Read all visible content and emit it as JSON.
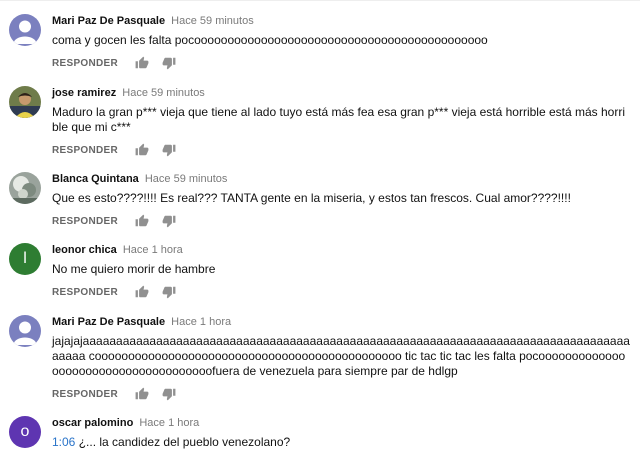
{
  "reply_label": "RESPONDER",
  "icons": {
    "like": "thumb-up-icon",
    "dislike": "thumb-down-icon"
  },
  "comments": [
    {
      "author": "Mari Paz De Pasquale",
      "time": "Hace 59 minutos",
      "text": "coma y gocen les falta pocoooooooooooooooooooooooooooooooooooooooooooo",
      "avatar": "default"
    },
    {
      "author": "jose ramirez",
      "time": "Hace 59 minutos",
      "text": "Maduro la gran p*** vieja que tiene al lado tuyo está más fea esa gran p*** vieja está horrible está más horrible que mi c***",
      "avatar": "photo"
    },
    {
      "author": "Blanca Quintana",
      "time": "Hace 59 minutos",
      "text": "Que es esto????!!!! Es real??? TANTA gente en la miseria, y estos tan frescos. Cual amor????!!!!",
      "avatar": "photo"
    },
    {
      "author": "leonor chica",
      "time": "Hace 1 hora",
      "text": "No me quiero morir de hambre",
      "avatar": "letter",
      "letter": "l",
      "color": "#2e7d32"
    },
    {
      "author": "Mari Paz De Pasquale",
      "time": "Hace 1 hora",
      "text": "jajajajaaaaaaaaaaaaaaaaaaaaaaaaaaaaaaaaaaaaaaaaaaaaaaaaaaaaaaaaaaaaaaaaaaaaaaaaaaaaaaaaaaaaaaa coooooooooooooooooooooooooooooooooooooooooooooo tic tac tic tac les falta pocooooooooooooooooooooooooooooooooooooofuera  de venezuela para siempre par de hdlgp",
      "avatar": "default"
    },
    {
      "author": "oscar palomino",
      "time": "Hace 1 hora",
      "timestamp": "1:06",
      "text": " ¿... la candidez del pueblo venezolano?",
      "avatar": "letter",
      "letter": "o",
      "color": "#5e35b1"
    }
  ]
}
